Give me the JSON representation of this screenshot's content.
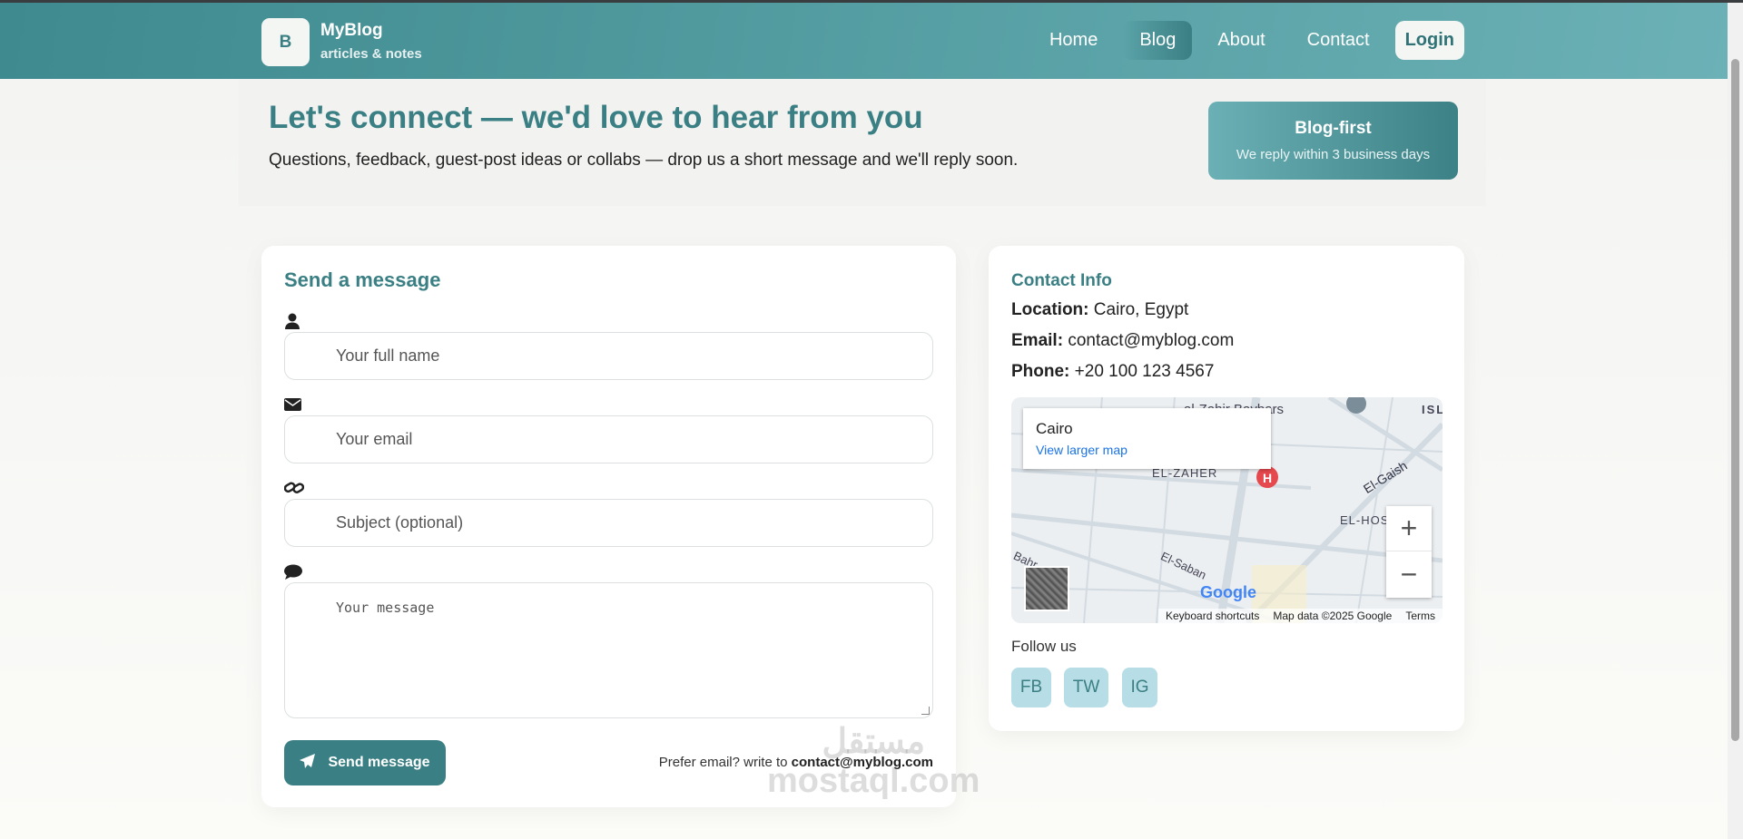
{
  "header": {
    "logo_letter": "B",
    "brand": "MyBlog",
    "tagline": "articles & notes",
    "nav": [
      "Home",
      "Blog",
      "About",
      "Contact"
    ],
    "login": "Login"
  },
  "hero": {
    "title": "Let's connect — we'd love to hear from you",
    "subtitle": "Questions, feedback, guest-post ideas or collabs — drop us a short message and we'll reply soon.",
    "badge_title": "Blog-first",
    "badge_sub": "We reply within 3 business days"
  },
  "form": {
    "title": "Send a message",
    "name_ph": "Your full name",
    "email_ph": "Your email",
    "subject_ph": "Subject (optional)",
    "message_ph": "Your message",
    "send": "Send message",
    "prefer": "Prefer email? write to",
    "prefer_email": "contact@myblog.com"
  },
  "info": {
    "title": "Contact Info",
    "location_label": "Location:",
    "location": "Cairo, Egypt",
    "email_label": "Email:",
    "email": "contact@myblog.com",
    "phone_label": "Phone:",
    "phone": "+20 100 123 4567",
    "follow": "Follow us",
    "social": [
      "FB",
      "TW",
      "IG"
    ]
  },
  "map": {
    "place": "Cairo",
    "larger": "View larger map",
    "shortcuts": "Keyboard shortcuts",
    "mapdata": "Map data ©2025 Google",
    "terms": "Terms",
    "labels": [
      "al-Zahir Baybars",
      "EL-ZAHER",
      "El-Gaish",
      "EL-HOS",
      "El-Saban",
      "Bahr",
      "ISL"
    ],
    "google": "Google"
  },
  "watermark": {
    "arabic": "مستقل",
    "latin": "mostaql.com"
  }
}
